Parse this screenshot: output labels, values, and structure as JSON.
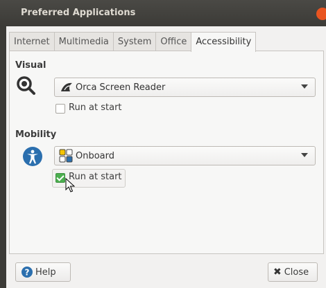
{
  "window": {
    "title": "Preferred Applications"
  },
  "tabs": [
    {
      "label": "Internet"
    },
    {
      "label": "Multimedia"
    },
    {
      "label": "System"
    },
    {
      "label": "Office"
    },
    {
      "label": "Accessibility",
      "active": true
    }
  ],
  "visual": {
    "heading": "Visual",
    "selected_app": "Orca Screen Reader",
    "run_at_start_label": "Run at start",
    "run_at_start_checked": false
  },
  "mobility": {
    "heading": "Mobility",
    "selected_app": "Onboard",
    "run_at_start_label": "Run at start",
    "run_at_start_checked": true
  },
  "buttons": {
    "help_label": "Help",
    "close_label": "Close"
  },
  "colors": {
    "close_accent": "#e95420",
    "accessibility_blue": "#2b6fae",
    "check_green": "#4caf50"
  }
}
